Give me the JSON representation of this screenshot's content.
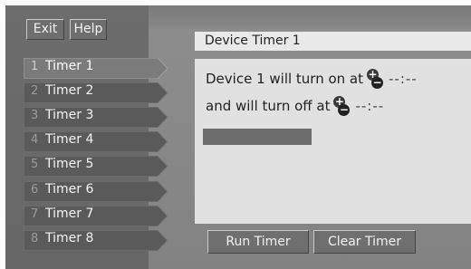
{
  "top": {
    "exit_label": "Exit",
    "help_label": "Help"
  },
  "tabs": [
    {
      "num": "1",
      "label": "Timer 1",
      "active": true
    },
    {
      "num": "2",
      "label": "Timer 2"
    },
    {
      "num": "3",
      "label": "Timer 3"
    },
    {
      "num": "4",
      "label": "Timer 4"
    },
    {
      "num": "5",
      "label": "Timer 5"
    },
    {
      "num": "6",
      "label": "Timer 6"
    },
    {
      "num": "7",
      "label": "Timer 7"
    },
    {
      "num": "8",
      "label": "Timer 8"
    }
  ],
  "main": {
    "title": "Device Timer 1",
    "on_text": "Device 1 will turn on at",
    "on_time": "--:--",
    "off_text": "and will turn off at",
    "off_time": "--:--"
  },
  "actions": {
    "run_label": "Run Timer",
    "clear_label": "Clear Timer"
  },
  "colors": {
    "tab_fill": "#5a5a5a",
    "active_tab_fill": "#7b7b7b",
    "panel": "#e1e1e1"
  }
}
